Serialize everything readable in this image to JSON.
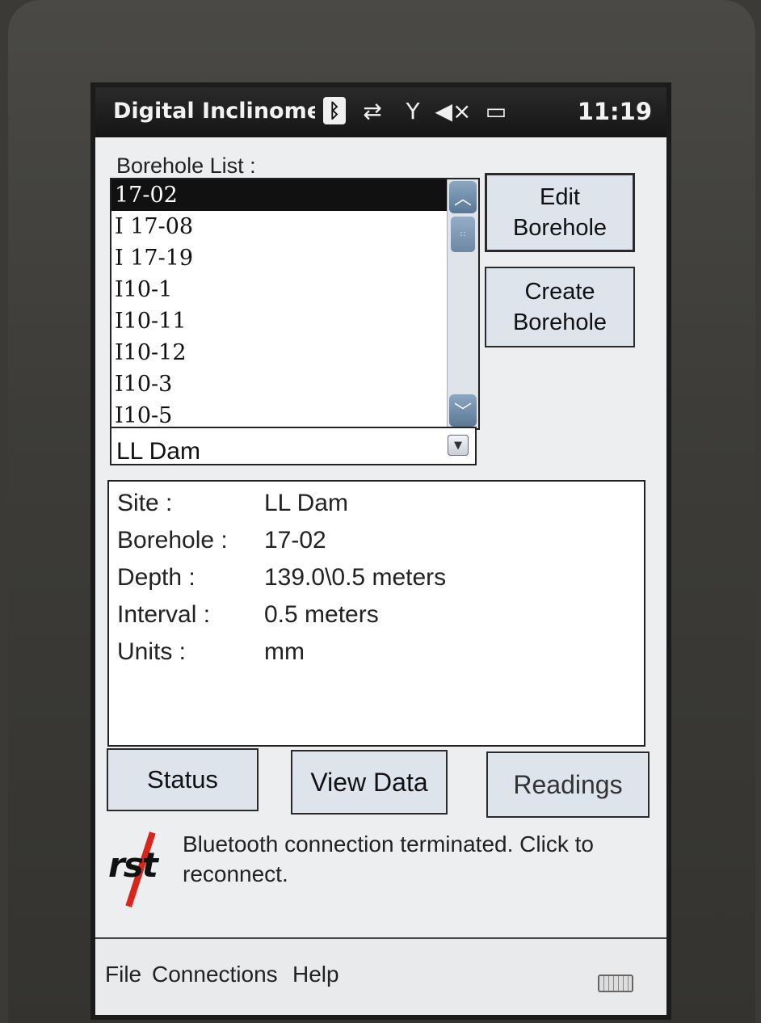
{
  "titlebar": {
    "app_title": "Digital Inclinomet",
    "clock": "11:19",
    "icons": [
      "bluetooth-icon",
      "data-sync-icon",
      "no-signal-icon",
      "speaker-muted-icon",
      "battery-icon"
    ]
  },
  "borehole_list": {
    "label": "Borehole List :",
    "items": [
      "17-02",
      "I 17-08",
      "I 17-19",
      "I10-1",
      "I10-11",
      "I10-12",
      "I10-3",
      "I10-5"
    ],
    "selected": "17-02"
  },
  "site_select": {
    "value": "LL Dam"
  },
  "buttons": {
    "edit_borehole": "Edit\nBorehole",
    "create_borehole": "Create\nBorehole",
    "status": "Status",
    "view_data": "View Data",
    "readings": "Readings"
  },
  "info": {
    "rows": [
      {
        "key": "Site :",
        "value": "LL Dam"
      },
      {
        "key": "Borehole :",
        "value": "17-02"
      },
      {
        "key": "Depth :",
        "value": "139.0\\0.5 meters"
      },
      {
        "key": "Interval :",
        "value": "0.5 meters"
      },
      {
        "key": "Units :",
        "value": "mm"
      }
    ]
  },
  "logo_text": "rst",
  "message": "Bluetooth connection terminated. Click to reconnect.",
  "menu": {
    "file": "File",
    "connections": "Connections",
    "help": "Help"
  },
  "colors": {
    "accent_red": "#d9261c",
    "button_bg": "#dde4ec",
    "titlebar": "#151515"
  }
}
